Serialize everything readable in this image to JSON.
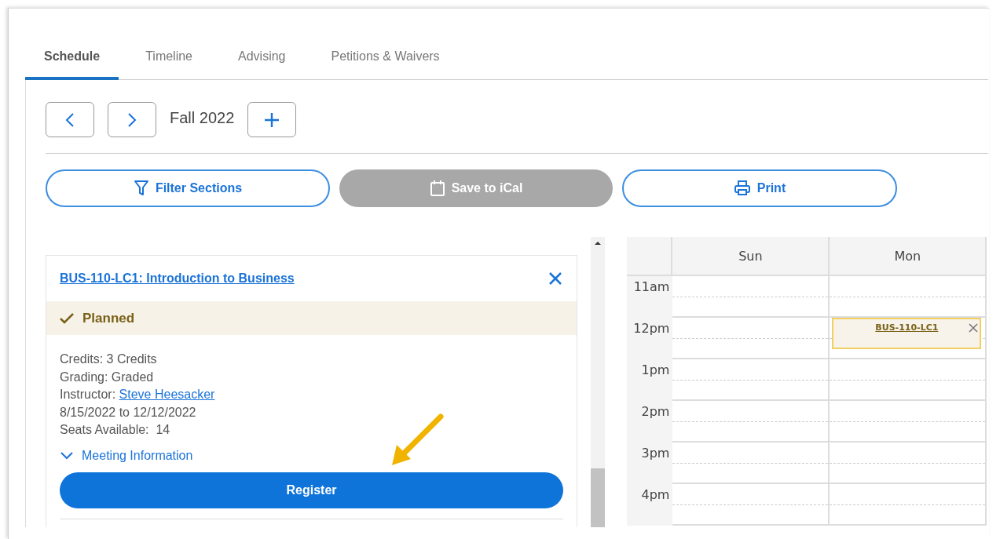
{
  "tabs": [
    {
      "label": "Schedule",
      "selected": true
    },
    {
      "label": "Timeline",
      "selected": false
    },
    {
      "label": "Advising",
      "selected": false
    },
    {
      "label": "Petitions & Waivers",
      "selected": false
    }
  ],
  "term": {
    "label": "Fall 2022"
  },
  "actions": [
    {
      "kind": "filter",
      "label": "Filter Sections",
      "disabled": false
    },
    {
      "kind": "ical",
      "label": "Save to iCal",
      "disabled": true
    },
    {
      "kind": "print",
      "label": "Print",
      "disabled": false
    }
  ],
  "course": {
    "title": "BUS-110-LC1: Introduction to Business",
    "status": "Planned",
    "details": [
      {
        "kind": "text",
        "label": "Credits:",
        "value": "3 Credits"
      },
      {
        "kind": "text",
        "label": "Grading:",
        "value": "Graded"
      },
      {
        "kind": "link",
        "label": "Instructor:",
        "value": "Steve Heesacker"
      },
      {
        "kind": "plain",
        "value": "8/15/2022 to 12/12/2022"
      },
      {
        "kind": "text",
        "label": "Seats Available: ",
        "value": "14"
      }
    ],
    "meeting": {
      "label": "Meeting Information",
      "expanded": false
    },
    "register": "Register"
  },
  "calendar": {
    "days": [
      "Sun",
      "Mon"
    ],
    "rows": [
      {
        "time": "11am"
      },
      {
        "time": "12pm",
        "cells": [
          null,
          {
            "event": "BUS-110-LC1"
          }
        ]
      },
      {
        "time": "1pm"
      },
      {
        "time": "2pm"
      },
      {
        "time": "3pm"
      },
      {
        "time": "4pm"
      }
    ]
  }
}
